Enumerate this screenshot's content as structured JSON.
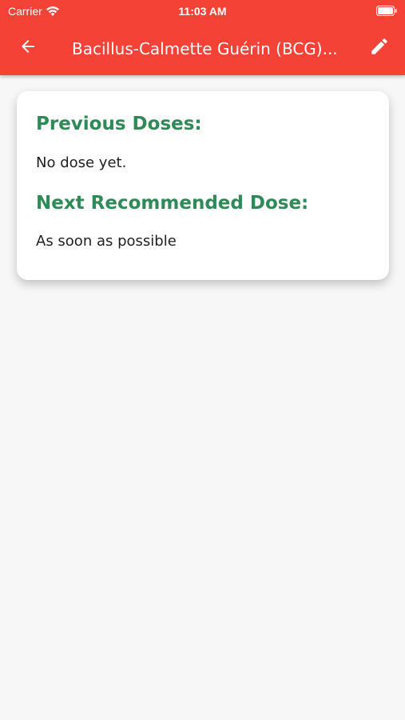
{
  "status_bar": {
    "carrier": "Carrier",
    "time": "11:03 AM"
  },
  "app_bar": {
    "title": "Bacillus-Calmette Guérin (BCG)...",
    "back_icon": "arrow-left-icon",
    "edit_icon": "pencil-icon",
    "background_color": "#f44336"
  },
  "card": {
    "previous_doses_heading": "Previous Doses:",
    "previous_doses_value": "No dose yet.",
    "next_dose_heading": "Next Recommended Dose:",
    "next_dose_value": "As soon as possible",
    "heading_color": "#2e8b57"
  }
}
